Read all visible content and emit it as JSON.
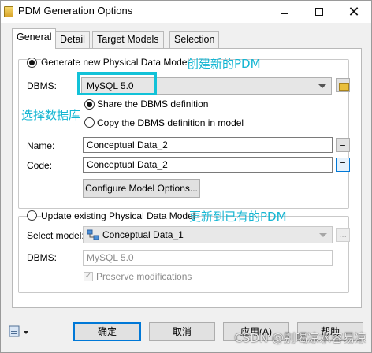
{
  "window": {
    "title": "PDM Generation Options",
    "minimize_icon": "minimize-icon",
    "maximize_icon": "maximize-icon",
    "close_icon": "close-icon"
  },
  "tabs": [
    {
      "label": "General",
      "active": true
    },
    {
      "label": "Detail",
      "active": false
    },
    {
      "label": "Target Models",
      "active": false
    },
    {
      "label": "Selection",
      "active": false
    }
  ],
  "generate_new": {
    "radio_label": "Generate new Physical Data Model",
    "selected": true,
    "dbms_label": "DBMS:",
    "dbms_value": "MySQL 5.0",
    "share_label": "Share the DBMS definition",
    "share_selected": true,
    "copy_label": "Copy the DBMS definition in model",
    "copy_selected": false,
    "name_label": "Name:",
    "name_value": "Conceptual Data_2",
    "code_label": "Code:",
    "code_value": "Conceptual Data_2",
    "equal_symbol": "=",
    "configure_button": "Configure Model Options..."
  },
  "update_existing": {
    "radio_label": "Update existing Physical Data Model",
    "selected": false,
    "select_model_label": "Select model:",
    "select_model_value": "Conceptual Data_1",
    "ellipsis": "...",
    "dbms_label": "DBMS:",
    "dbms_value": "MySQL 5.0",
    "preserve_label": "Preserve modifications",
    "preserve_checked": true
  },
  "annotations": {
    "create_new": "创建新的PDM",
    "select_db": "选择数据库",
    "update_existing": "更新到已有的PDM"
  },
  "buttons": {
    "ok": "确定",
    "cancel": "取消",
    "apply": "应用(A)",
    "help": "帮助"
  },
  "watermark": "CSDN @别喝凉水容易凉",
  "colors": {
    "annotation": "#12b5d2",
    "focus_blue": "#0078d7"
  }
}
